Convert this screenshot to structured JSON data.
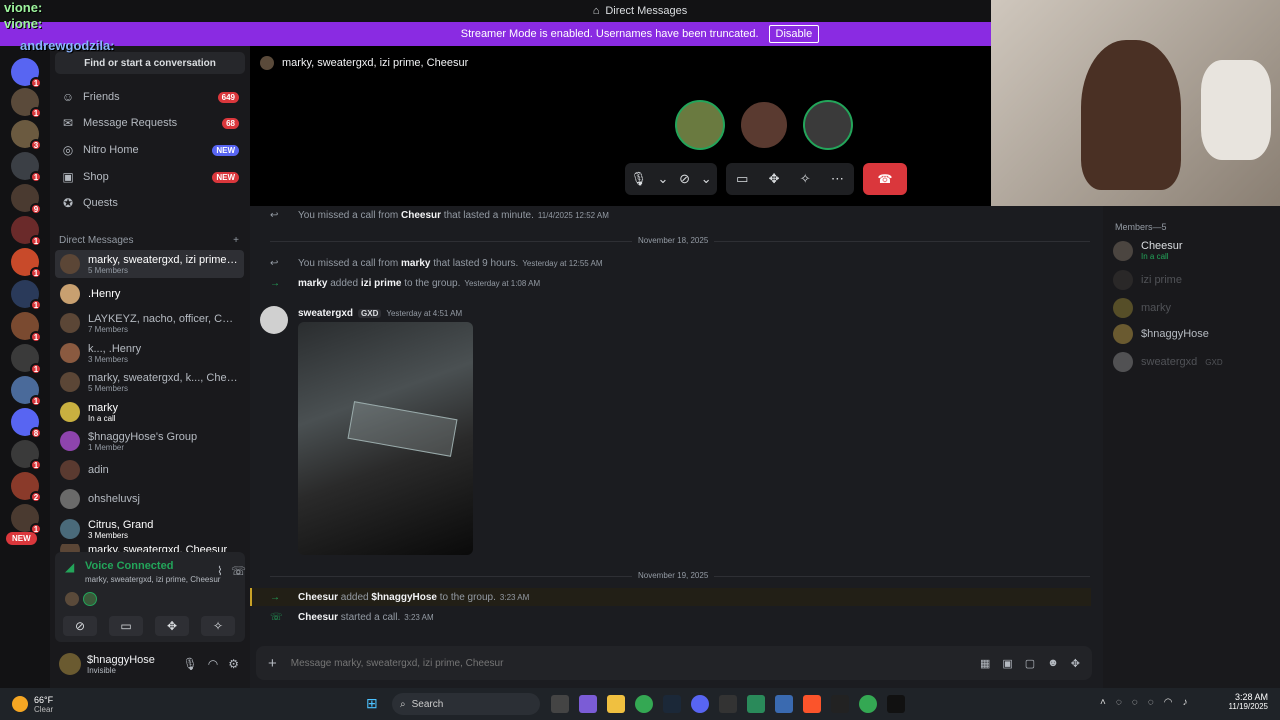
{
  "window": {
    "title": "Direct Messages"
  },
  "banner": {
    "text": "Streamer Mode is enabled. Usernames have been truncated.",
    "button": "Disable"
  },
  "overlay": {
    "line1": "vione:",
    "line2": "vione:",
    "line3": "andrewgodzila:"
  },
  "servers": {
    "badges": [
      "1",
      "1",
      "3",
      "1",
      "9",
      "1",
      "1",
      "1",
      "1",
      "1",
      "1",
      "8",
      "1",
      "2",
      "1",
      "1",
      "1",
      "1"
    ],
    "new_label": "NEW"
  },
  "sidebar": {
    "find": "Find or start a conversation",
    "nav": [
      {
        "label": "Friends",
        "count": "649"
      },
      {
        "label": "Message Requests",
        "count": "68"
      },
      {
        "label": "Nitro Home",
        "count": "NEW"
      },
      {
        "label": "Shop",
        "count": "NEW"
      },
      {
        "label": "Quests",
        "count": ""
      }
    ],
    "dm_header": "Direct Messages",
    "dm_add": "+",
    "dms": [
      {
        "name": "marky, sweatergxd, izi prime, ...",
        "sub": "5 Members"
      },
      {
        "name": ".Henry",
        "sub": ""
      },
      {
        "name": "LAYKEYZ, nacho, officer, CEO...",
        "sub": "7 Members"
      },
      {
        "name": "k..., .Henry",
        "sub": "3 Members"
      },
      {
        "name": "marky, sweatergxd, k..., Chees...",
        "sub": "5 Members"
      },
      {
        "name": "marky",
        "sub": "In a call"
      },
      {
        "name": "$hnaggyHose's Group",
        "sub": "1 Member"
      },
      {
        "name": "adin",
        "sub": ""
      },
      {
        "name": "ohsheluvsj",
        "sub": ""
      },
      {
        "name": "Citrus, Grand",
        "sub": "3 Members"
      },
      {
        "name": "marky, sweatergxd, Cheesur",
        "sub": ""
      }
    ],
    "voice": {
      "status": "Voice Connected",
      "channel": "marky, sweatergxd, izi prime, Cheesur"
    },
    "user": {
      "name": "$hnaggyHose",
      "status": "Invisible"
    }
  },
  "call": {
    "header": "marky, sweatergxd, izi prime, Cheesur"
  },
  "chat": {
    "messages": [
      {
        "pre": "You missed a call from ",
        "who": "Cheesur",
        "post": " that lasted a minute.",
        "ts": "11/4/2025 12:52 AM"
      },
      {
        "pre": "You missed a call from ",
        "who": "marky",
        "post": " that lasted 9 hours.",
        "ts": "Yesterday at 12:55 AM"
      },
      {
        "pre": "",
        "who": "marky",
        "post": " added ",
        "who2": "izi prime",
        "post2": " to the group.",
        "ts": "Yesterday at 1:08 AM"
      },
      {
        "pre": "",
        "who": "Cheesur",
        "post": " added ",
        "who2": "$hnaggyHose",
        "post2": " to the group.",
        "ts": "3:23 AM"
      },
      {
        "pre": "",
        "who": "Cheesur",
        "post": " started a call.",
        "ts": "3:23 AM"
      }
    ],
    "date1": "November 18, 2025",
    "date2": "November 19, 2025",
    "post_author": "sweatergxd",
    "post_tag": "GXD",
    "post_ts": "Yesterday at 4:51 AM",
    "input_placeholder": "Message marky, sweatergxd, izi prime, Cheesur"
  },
  "members": {
    "header": "Members—5",
    "list": [
      {
        "name": "Cheesur",
        "sub": "In a call"
      },
      {
        "name": "izi prime",
        "sub": ""
      },
      {
        "name": "marky",
        "sub": ""
      },
      {
        "name": "$hnaggyHose",
        "sub": ""
      },
      {
        "name": "sweatergxd",
        "sub": "GXD"
      }
    ]
  },
  "taskbar": {
    "weather_temp": "66°F",
    "weather_desc": "Clear",
    "search": "Search",
    "time": "3:28 AM",
    "date": "11/19/2025"
  }
}
